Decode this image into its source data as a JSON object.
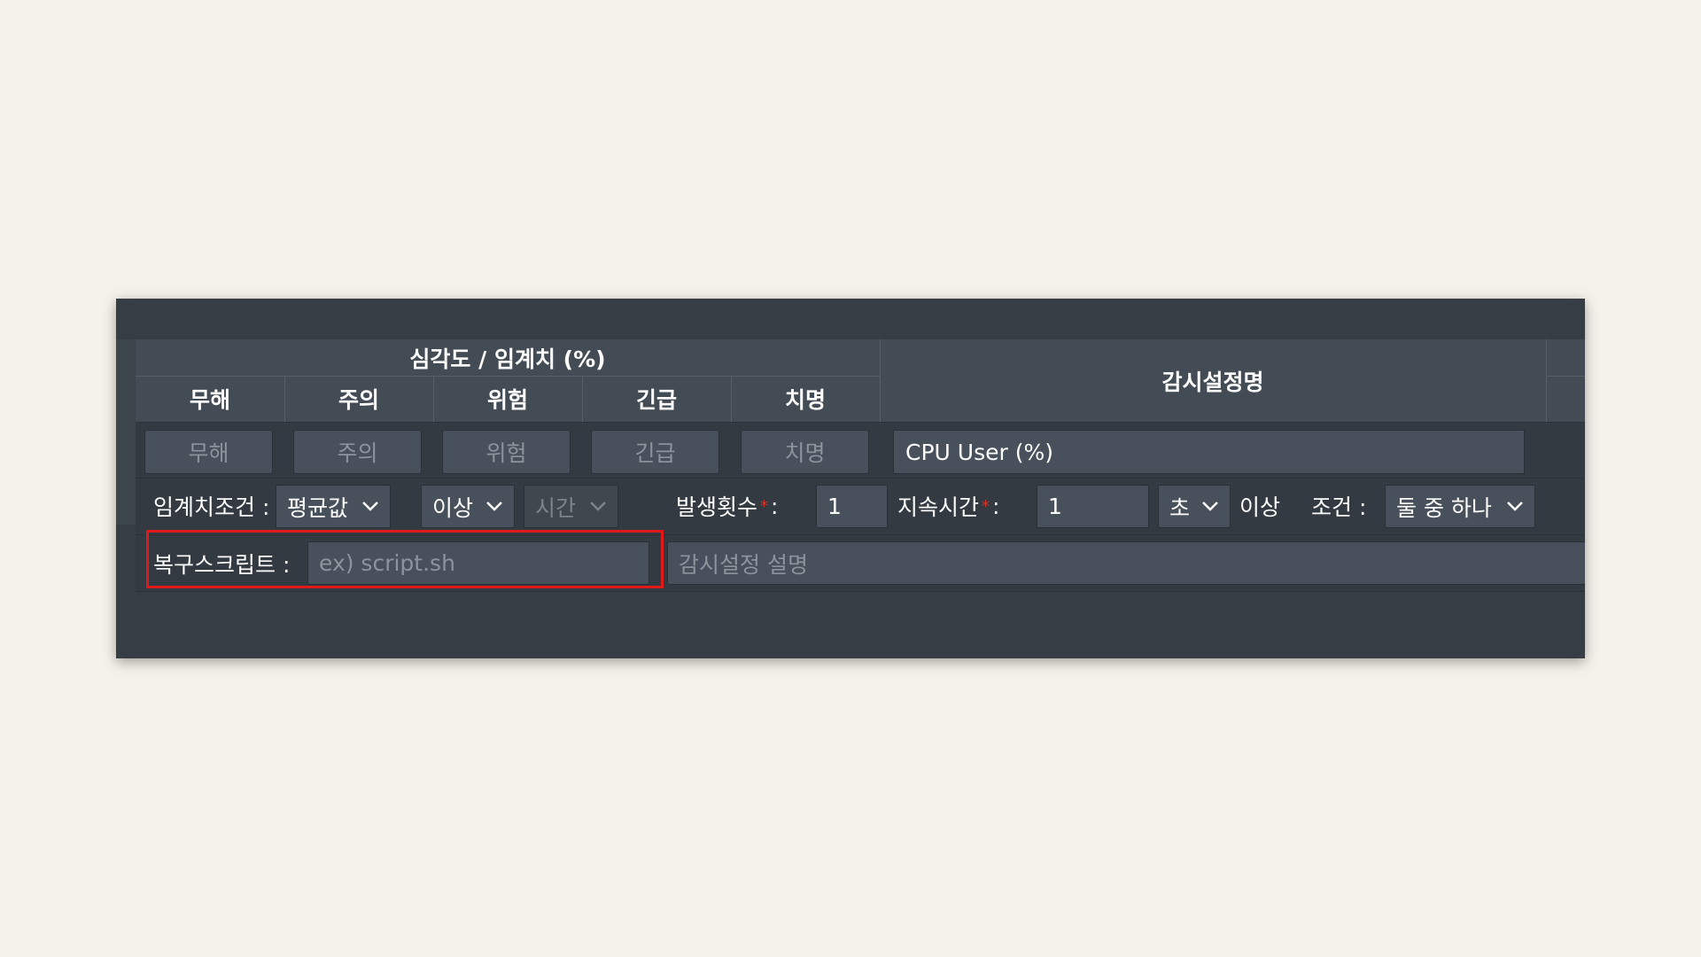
{
  "header": {
    "group_title": "심각도 / 임계치 (%)",
    "severity_headers": [
      "무해",
      "주의",
      "위험",
      "긴급",
      "치명"
    ],
    "name_header": "감시설정명"
  },
  "severity_row": {
    "placeholders": [
      "무해",
      "주의",
      "위험",
      "긴급",
      "치명"
    ],
    "name_value": "CPU User (%)"
  },
  "condition_row": {
    "threshold_label": "임계치조건 :",
    "agg_select": "평균값",
    "compare_select": "이상",
    "time_select": "시간",
    "count_label": "발생횟수",
    "count_value": "1",
    "duration_label": "지속시간",
    "duration_value": "1",
    "unit_select": "초",
    "above_text": "이상",
    "cond_label": "조건 :",
    "cond_select": "둘 중 하나",
    "required_mark": "*",
    "colon": ":"
  },
  "script_row": {
    "label": "복구스크립트 :",
    "script_placeholder": "ex) script.sh",
    "desc_placeholder": "감시설정 설명"
  },
  "colors": {
    "highlight": "#e01a1a",
    "panel": "#363d45",
    "page_bg": "#f5f2ea",
    "required": "#d7312c"
  }
}
